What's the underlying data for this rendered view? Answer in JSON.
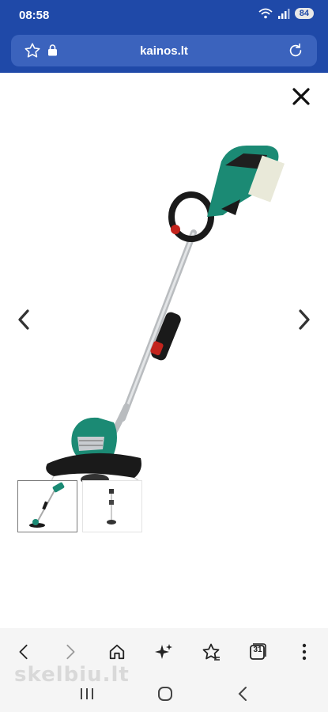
{
  "status_bar": {
    "time": "08:58",
    "battery": "84",
    "icons": [
      "wifi-icon",
      "signal-icon",
      "battery-icon"
    ]
  },
  "browser": {
    "url": "kainos.lt",
    "left_icons": [
      "star-outline-icon",
      "lock-icon"
    ],
    "right_icon": "reload-icon",
    "accent_color": "#1f49a8"
  },
  "viewer": {
    "close_icon": "close-icon",
    "prev_icon": "chevron-left-icon",
    "next_icon": "chevron-right-icon",
    "image_alt_icon": "grass-trimmer-image",
    "thumbnails": [
      {
        "name": "thumbnail-trimmer",
        "active": true
      },
      {
        "name": "thumbnail-trimmer-side",
        "active": false
      }
    ]
  },
  "toolbar": {
    "tab_count": "31",
    "items": [
      "back-icon",
      "forward-icon",
      "home-icon",
      "sparkle-icon",
      "bookmark-star-icon",
      "tabs-icon",
      "more-icon"
    ]
  },
  "watermark": "skelbiu.lt",
  "system_nav": [
    "recents-icon",
    "home-circle-icon",
    "system-back-icon"
  ]
}
